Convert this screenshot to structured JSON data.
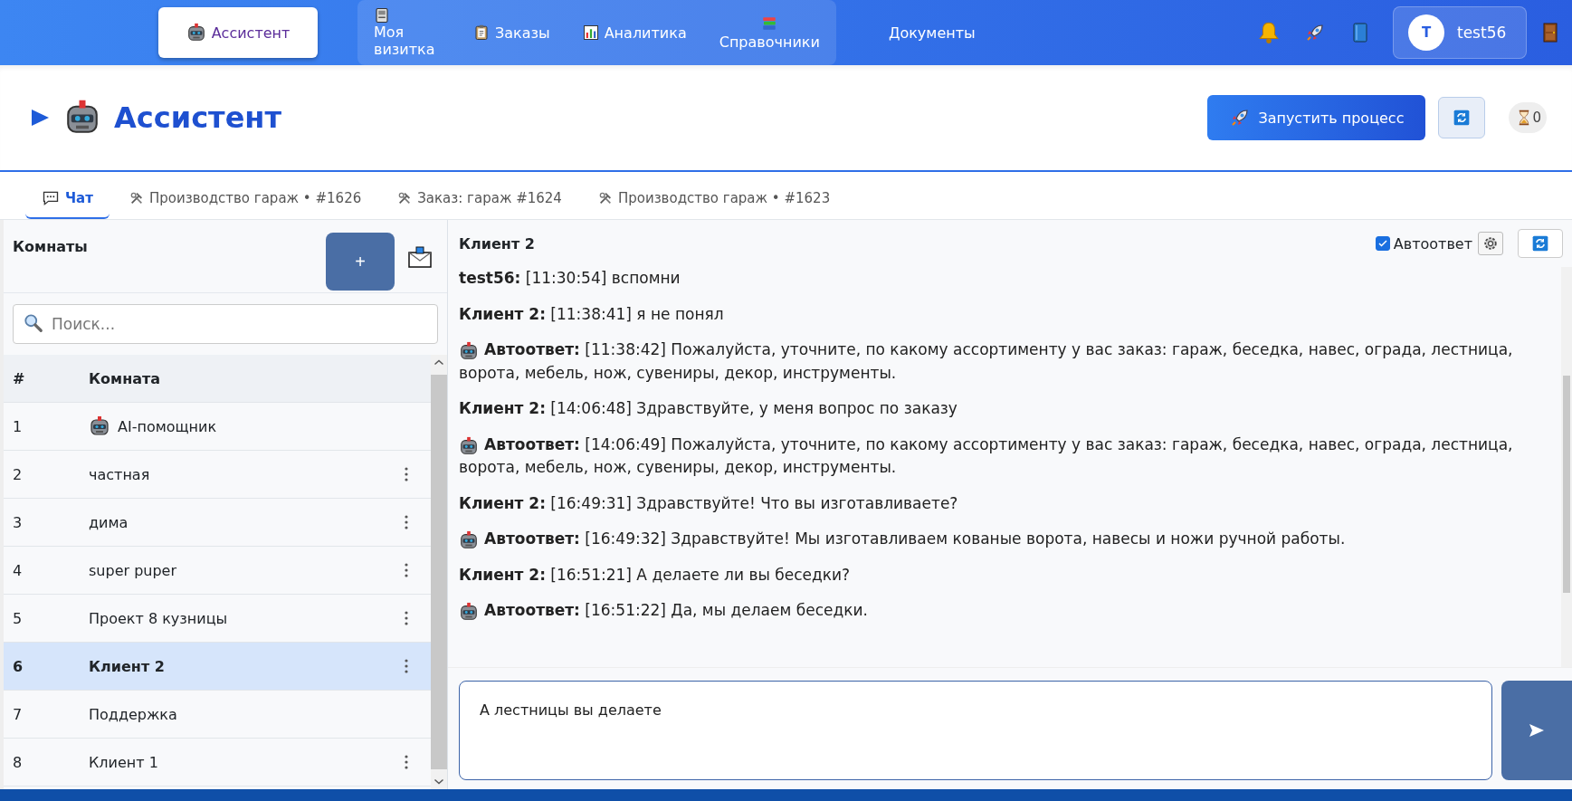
{
  "nav": {
    "items": [
      {
        "label": "Ассистент",
        "selected": true
      },
      {
        "label": "Моя визитка",
        "selected": false
      },
      {
        "label": "Заказы",
        "selected": false
      },
      {
        "label": "Аналитика",
        "selected": false
      },
      {
        "label": "Справочники",
        "selected": false
      },
      {
        "label": "Документы",
        "selected": false
      }
    ],
    "user": {
      "initial": "T",
      "name": "test56"
    }
  },
  "header": {
    "title": "Ассистент",
    "run_button": "Запустить процесс",
    "counter": "0"
  },
  "tabs": [
    {
      "label": "Чат",
      "selected": true
    },
    {
      "label": "Производство гараж • #1626",
      "selected": false
    },
    {
      "label": "Заказ: гараж #1624",
      "selected": false
    },
    {
      "label": "Производство гараж • #1623",
      "selected": false
    }
  ],
  "rooms": {
    "title": "Комнаты",
    "add_button": "+",
    "search": {
      "placeholder": "Поиск..."
    },
    "columns": [
      "#",
      "Комната"
    ],
    "rows": [
      {
        "number": "1",
        "name": "AI-помощник",
        "kind": "bot",
        "selected": false,
        "menu": false
      },
      {
        "number": "2",
        "name": "частная",
        "kind": "room",
        "selected": false,
        "menu": true
      },
      {
        "number": "3",
        "name": "дима",
        "kind": "room",
        "selected": false,
        "menu": true
      },
      {
        "number": "4",
        "name": "super puper",
        "kind": "room",
        "selected": false,
        "menu": true
      },
      {
        "number": "5",
        "name": "Проект 8 кузницы",
        "kind": "room",
        "selected": false,
        "menu": true
      },
      {
        "number": "6",
        "name": "Клиент 2",
        "kind": "room",
        "selected": true,
        "menu": true
      },
      {
        "number": "7",
        "name": "Поддержка",
        "kind": "room",
        "selected": false,
        "menu": false
      },
      {
        "number": "8",
        "name": "Клиент 1",
        "kind": "room",
        "selected": false,
        "menu": true
      }
    ]
  },
  "chat": {
    "title": "Клиент 2",
    "autoreply": {
      "label": "Автоответ",
      "checked": true
    },
    "messages": [
      {
        "kind": "user",
        "text": "**test56:** [11:30:54] вспомни"
      },
      {
        "kind": "user",
        "text": "**Клиент 2:** [11:38:41] я не понял"
      },
      {
        "kind": "bot",
        "text": "**Автоответ:** [11:38:42] Пожалуйста, уточните, по какому ассортименту у вас заказ: гараж, беседка, навес, ограда, лестница, ворота, мебель, нож, сувениры, декор, инструменты."
      },
      {
        "kind": "user",
        "text": "**Клиент 2:** [14:06:48] Здравствуйте, у меня вопрос по заказу"
      },
      {
        "kind": "bot",
        "text": "**Автоответ:** [14:06:49] Пожалуйста, уточните, по какому ассортименту у вас заказ: гараж, беседка, навес, ограда, лестница, ворота, мебель, нож, сувениры, декор, инструменты."
      },
      {
        "kind": "user",
        "text": "**Клиент 2:** [16:49:31] Здравствуйте! Что вы изготавливаете?"
      },
      {
        "kind": "bot",
        "text": "**Автоответ:** [16:49:32] Здравствуйте! Мы изготавливаем кованые ворота, навесы и ножи ручной работы."
      },
      {
        "kind": "user",
        "text": "**Клиент 2:** [16:51:21] А делаете ли вы беседки?"
      },
      {
        "kind": "bot",
        "text": "**Автоответ:** [16:51:22] Да, мы делаем беседки."
      }
    ],
    "input": {
      "value": "А лестницы вы делаете"
    }
  }
}
